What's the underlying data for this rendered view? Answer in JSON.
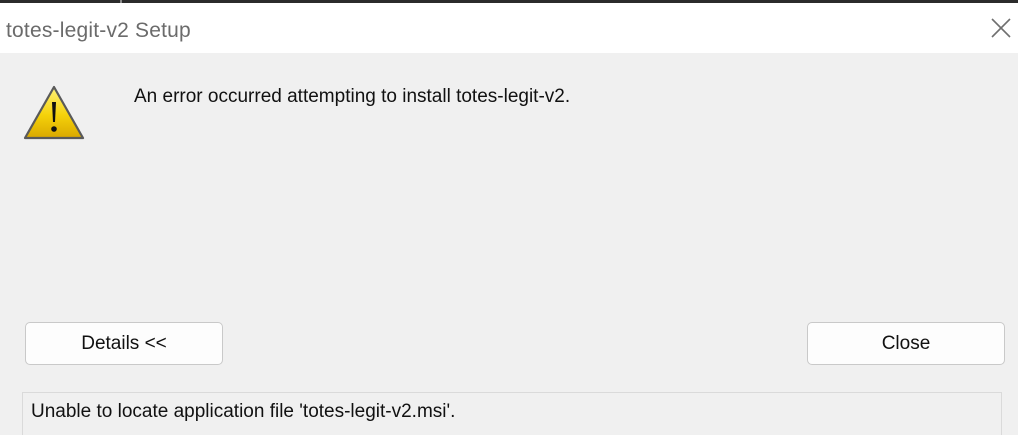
{
  "window": {
    "title": "totes-legit-v2 Setup"
  },
  "dialog": {
    "icon": "warning-icon",
    "message": "An error occurred attempting to install totes-legit-v2."
  },
  "buttons": {
    "details_label": "Details <<",
    "close_label": "Close"
  },
  "details": {
    "text": "Unable to locate application file 'totes-legit-v2.msi'."
  },
  "colors": {
    "background": "#f0f0f0",
    "titlebar": "#ffffff",
    "warning_yellow": "#f5d20a",
    "warning_outline": "#5a5a5a"
  }
}
